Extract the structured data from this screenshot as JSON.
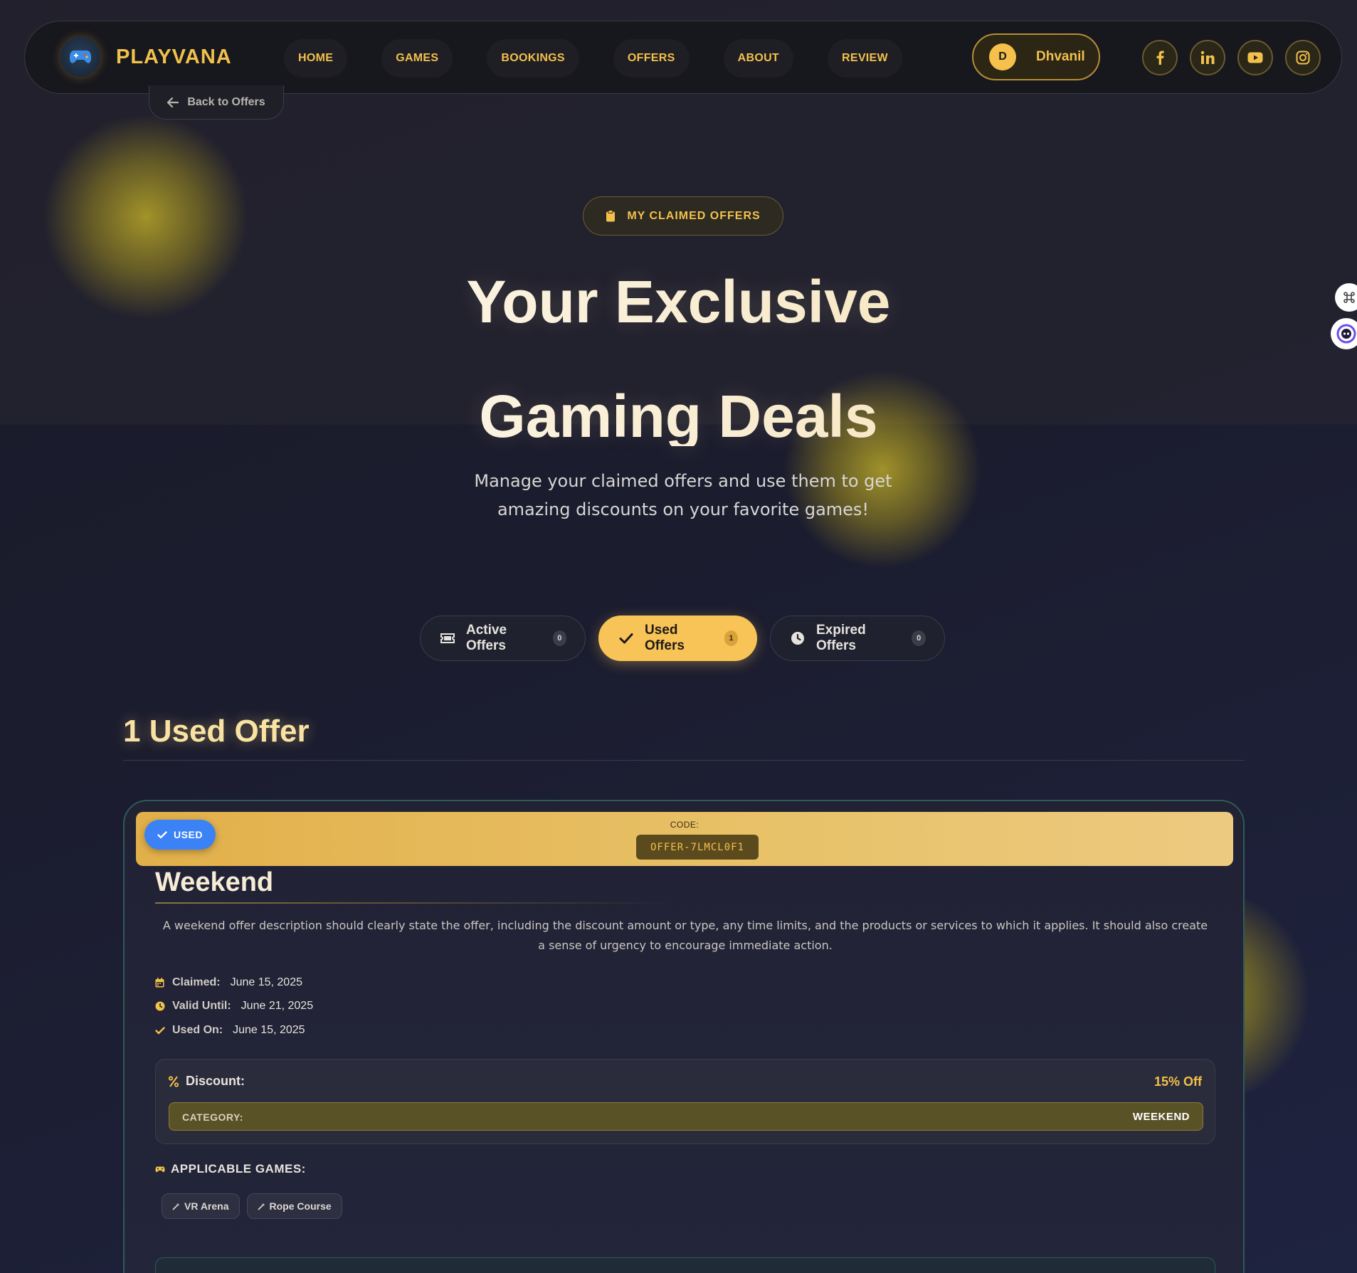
{
  "brand": {
    "name": "PLAYVANA",
    "accent": "#f2c14b"
  },
  "nav": {
    "links": [
      "HOME",
      "GAMES",
      "BOOKINGS",
      "OFFERS",
      "ABOUT",
      "REVIEW"
    ],
    "user": {
      "initial": "D",
      "name": "Dhvanil"
    },
    "socials": [
      "facebook-icon",
      "linkedin-icon",
      "youtube-icon",
      "instagram-icon"
    ]
  },
  "back_label": "Back to Offers",
  "hero": {
    "badge": "MY CLAIMED OFFERS",
    "title_line1": "Your Exclusive",
    "title_line2": "Gaming Deals",
    "subtitle": "Manage your claimed offers and use them to get amazing discounts on your favorite games!"
  },
  "tabs": [
    {
      "label": "Active Offers",
      "count": "0",
      "icon": "ticket-icon",
      "active": false
    },
    {
      "label": "Used Offers",
      "count": "1",
      "icon": "check-icon",
      "active": true
    },
    {
      "label": "Expired Offers",
      "count": "0",
      "icon": "clock-icon",
      "active": false
    }
  ],
  "section_title": "1 Used Offer",
  "offer": {
    "status": "USED",
    "code_label": "CODE:",
    "code": "OFFER-7LMCL0F1",
    "title": "Weekend",
    "description": "A weekend offer description should clearly state the offer, including the discount amount or type, any time limits, and the products or services to which it applies. It should also create a sense of urgency to encourage immediate action.",
    "meta": [
      {
        "label": "Claimed:",
        "value": "June 15, 2025",
        "icon": "calendar-icon"
      },
      {
        "label": "Valid Until:",
        "value": "June 21, 2025",
        "icon": "clock-icon"
      },
      {
        "label": "Used On:",
        "value": "June 15, 2025",
        "icon": "check-icon"
      }
    ],
    "discount_label": "Discount:",
    "discount_value": "15% Off",
    "category_label": "CATEGORY:",
    "category_value": "WEEKEND",
    "games_label": "APPLICABLE GAMES:",
    "games": [
      "VR Arena",
      "Rope Course"
    ]
  },
  "colors": {
    "used_badge": "#3b82f6",
    "active_tab": "#f8c357",
    "card_border": "#2f5a57"
  }
}
